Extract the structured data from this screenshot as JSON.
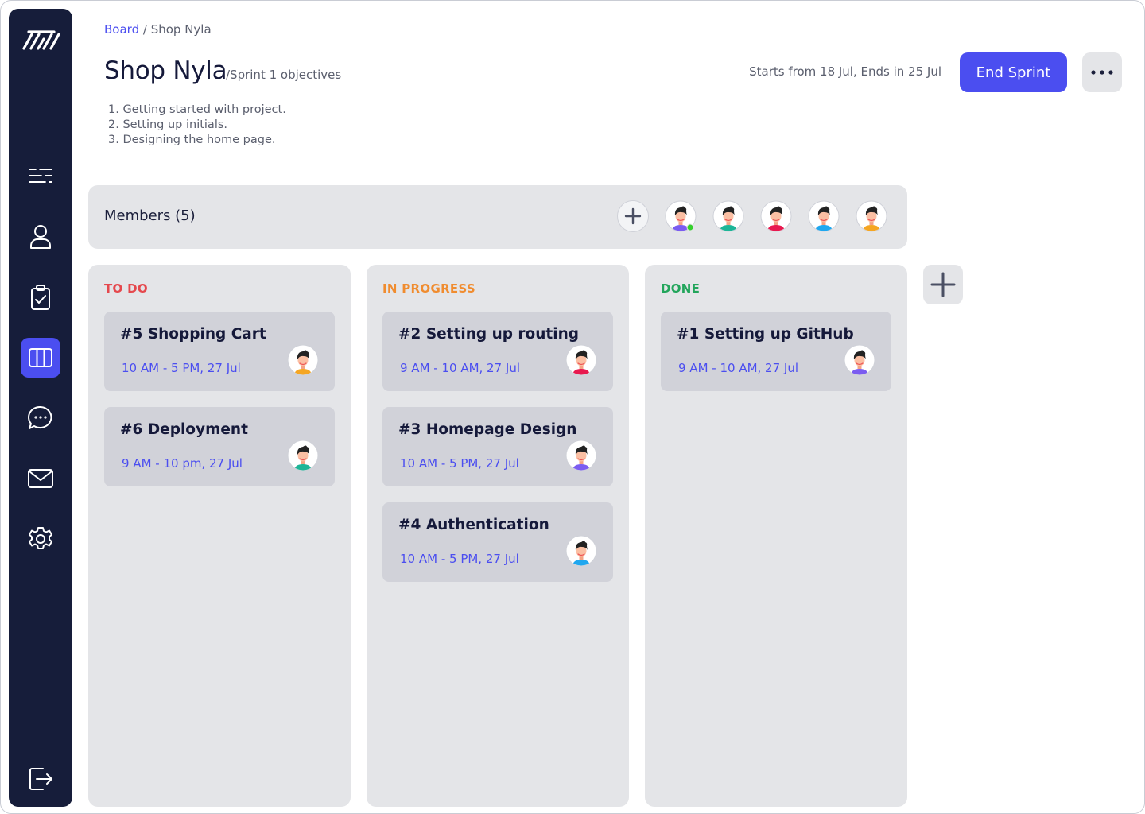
{
  "breadcrumb": {
    "root": "Board",
    "separator": "/",
    "current": "Shop Nyla"
  },
  "header": {
    "title": "Shop Nyla",
    "subtitle": "/Sprint 1 objectives",
    "objectives": [
      "1. Getting started with project.",
      "2. Setting up initials.",
      "3. Designing the home page."
    ],
    "sprint_dates": "Starts from 18 Jul, Ends in 25 Jul",
    "end_sprint_label": "End Sprint",
    "more_icon": "more-horizontal-icon"
  },
  "sidebar": {
    "logo": "brand-logo",
    "items": [
      {
        "icon": "menu-icon",
        "active": false
      },
      {
        "icon": "user-icon",
        "active": false
      },
      {
        "icon": "clipboard-check-icon",
        "active": false
      },
      {
        "icon": "board-columns-icon",
        "active": true
      },
      {
        "icon": "chat-icon",
        "active": false
      },
      {
        "icon": "mail-icon",
        "active": false
      },
      {
        "icon": "settings-icon",
        "active": false
      }
    ],
    "logout_icon": "logout-icon",
    "colors": {
      "background": "#161d3a",
      "active": "#4b4ef0"
    }
  },
  "members": {
    "label": "Members (5)",
    "add_icon": "plus-icon",
    "avatars": [
      {
        "shirt": "#7b5cf0",
        "online": true
      },
      {
        "shirt": "#1db597",
        "online": false
      },
      {
        "shirt": "#e8194f",
        "online": false
      },
      {
        "shirt": "#20a7ef",
        "online": false
      },
      {
        "shirt": "#f5a623",
        "online": false
      }
    ]
  },
  "columns": [
    {
      "title": "TO DO",
      "color": "#e5484d",
      "cards": [
        {
          "title": "#5 Shopping Cart",
          "time": "10 AM - 5 PM, 27 Jul",
          "shirt": "#f5a623"
        },
        {
          "title": "#6 Deployment",
          "time": "9 AM - 10 pm, 27 Jul",
          "shirt": "#1db597"
        }
      ]
    },
    {
      "title": "IN PROGRESS",
      "color": "#f08c2f",
      "cards": [
        {
          "title": "#2 Setting up routing",
          "time": "9 AM - 10 AM, 27 Jul",
          "shirt": "#e8194f"
        },
        {
          "title": "#3 Homepage Design",
          "time": "10 AM - 5 PM, 27 Jul",
          "shirt": "#7b5cf0"
        },
        {
          "title": "#4 Authentication",
          "time": "10 AM - 5 PM, 27 Jul",
          "shirt": "#20a7ef"
        }
      ]
    },
    {
      "title": "DONE",
      "color": "#22a55b",
      "cards": [
        {
          "title": "#1 Setting up GitHub",
          "time": "9 AM - 10 AM, 27 Jul",
          "shirt": "#7b5cf0"
        }
      ]
    }
  ],
  "add_column_icon": "plus-icon",
  "accent": "#4b4ef0"
}
